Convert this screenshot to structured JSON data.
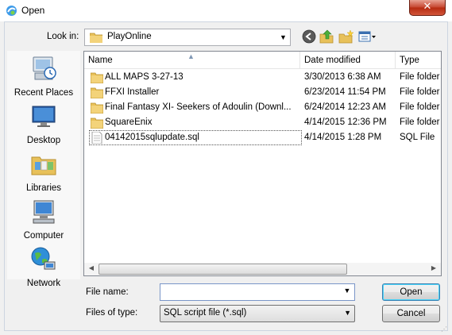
{
  "window": {
    "title": "Open",
    "close_glyph": "✕",
    "app_icon": "dialog-app-icon"
  },
  "toolbar": {
    "look_in_label": "Look in:",
    "look_in_value": "PlayOnline",
    "buttons": [
      {
        "name": "back-button",
        "icon": "back-arrow-icon"
      },
      {
        "name": "up-one-level-button",
        "icon": "folder-up-icon"
      },
      {
        "name": "create-new-folder-button",
        "icon": "new-folder-icon"
      },
      {
        "name": "view-menu-button",
        "icon": "view-menu-icon"
      }
    ]
  },
  "places": [
    {
      "label": "Recent Places",
      "icon": "recent-places-icon"
    },
    {
      "label": "Desktop",
      "icon": "desktop-icon"
    },
    {
      "label": "Libraries",
      "icon": "libraries-icon"
    },
    {
      "label": "Computer",
      "icon": "computer-icon"
    },
    {
      "label": "Network",
      "icon": "network-icon"
    }
  ],
  "file_list": {
    "columns": [
      "Name",
      "Date modified",
      "Type"
    ],
    "sorted_column": "Name",
    "rows": [
      {
        "name": "ALL MAPS 3-27-13",
        "date": "3/30/2013 6:38 AM",
        "type": "File folder",
        "icon": "folder-icon",
        "selected": false
      },
      {
        "name": "FFXI Installer",
        "date": "6/23/2014 11:54 PM",
        "type": "File folder",
        "icon": "folder-icon",
        "selected": false
      },
      {
        "name": "Final Fantasy XI- Seekers of Adoulin (Downl...",
        "date": "6/24/2014 12:23 AM",
        "type": "File folder",
        "icon": "folder-icon",
        "selected": false
      },
      {
        "name": "SquareEnix",
        "date": "4/14/2015 12:36 PM",
        "type": "File folder",
        "icon": "folder-icon",
        "selected": false
      },
      {
        "name": "04142015sqlupdate.sql",
        "date": "4/14/2015 1:28 PM",
        "type": "SQL File",
        "icon": "sql-file-icon",
        "selected": true
      }
    ]
  },
  "footer": {
    "file_name_label": "File name:",
    "file_name_value": "",
    "files_of_type_label": "Files of type:",
    "files_of_type_value": "SQL script file (*.sql)",
    "open_label": "Open",
    "cancel_label": "Cancel"
  },
  "colors": {
    "close_button": "#c5432c",
    "folder": "#e8c15a",
    "frame": "#f0f0f0",
    "list_border": "#828790"
  }
}
